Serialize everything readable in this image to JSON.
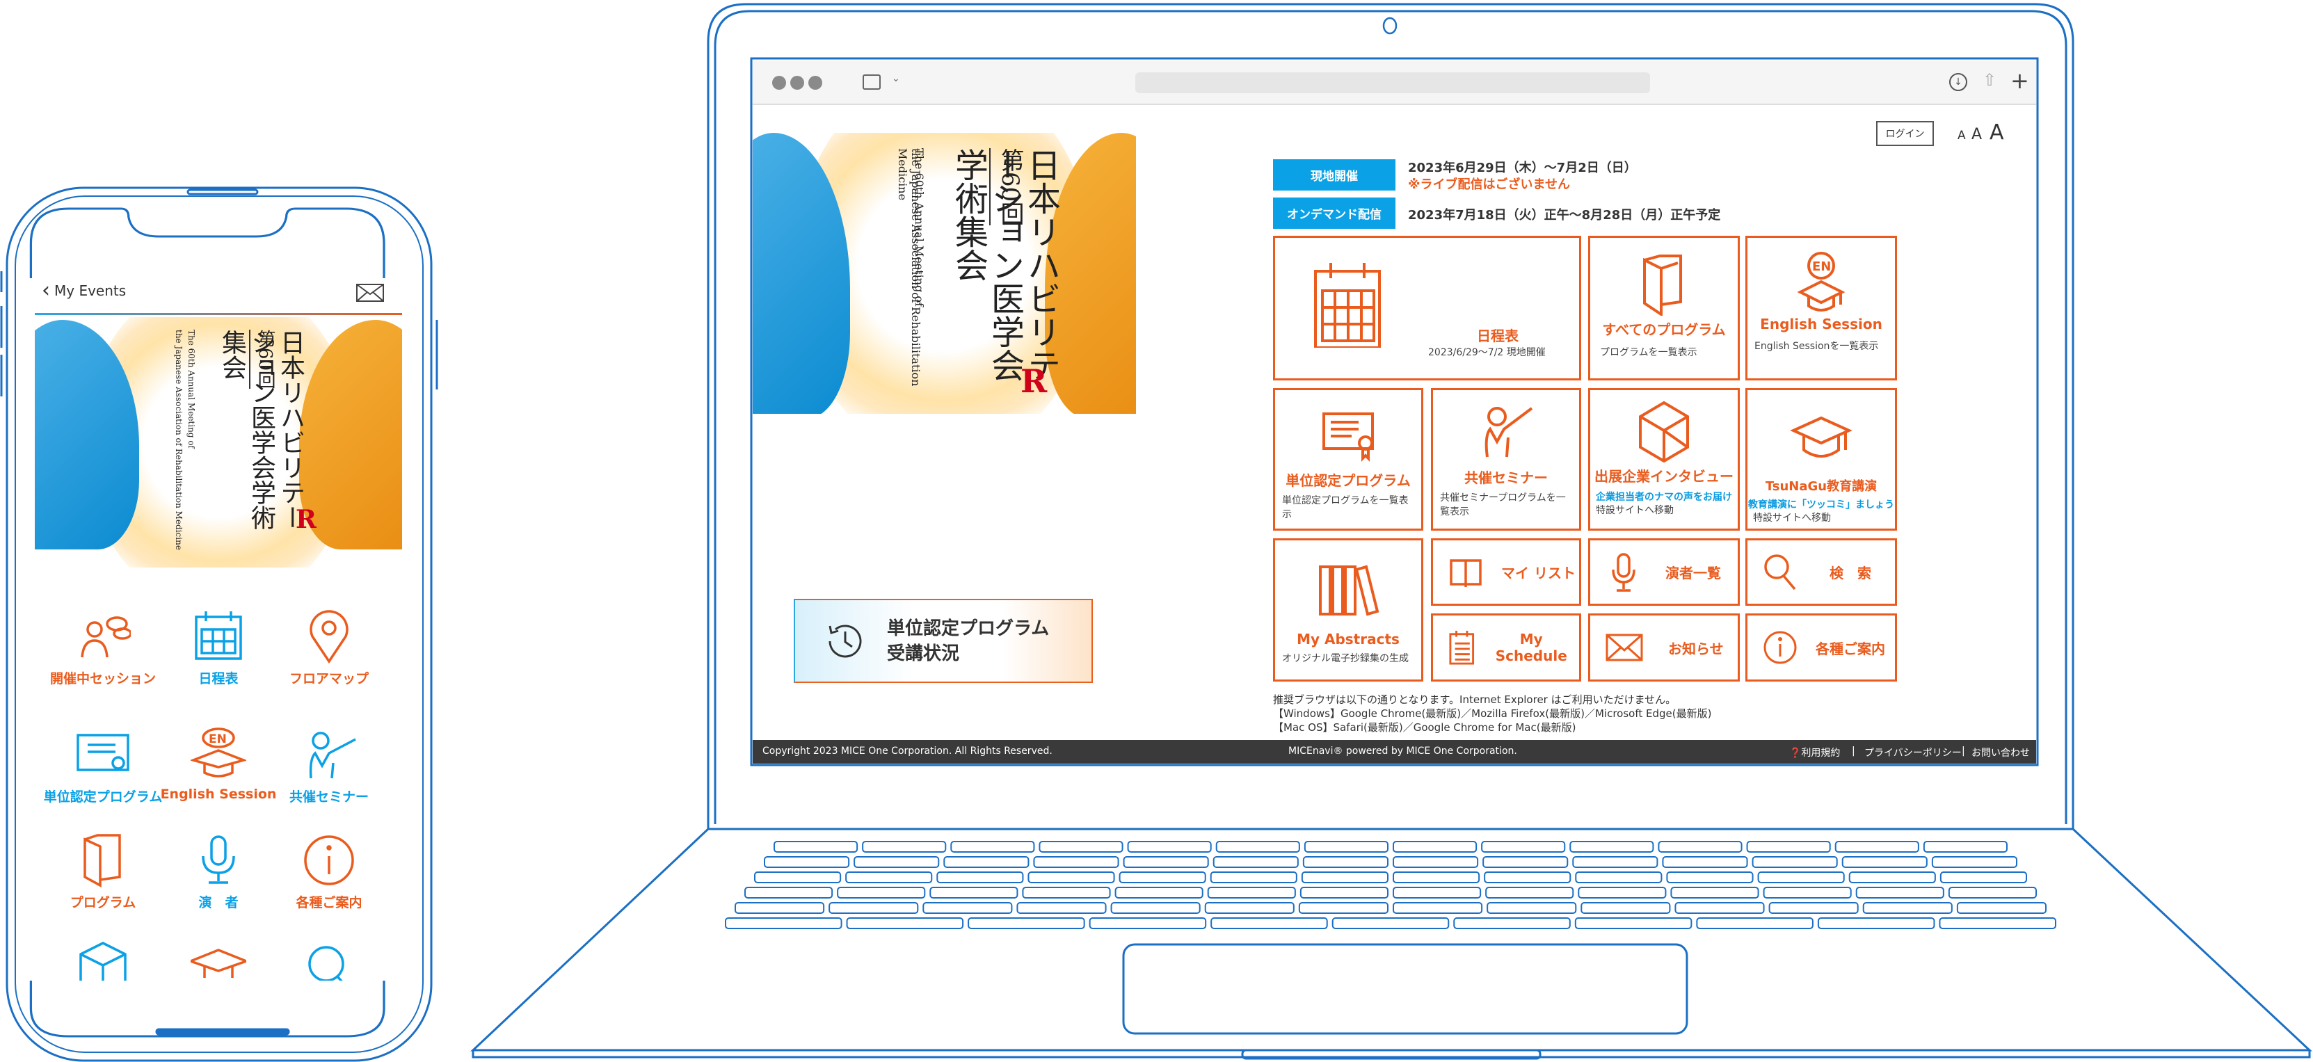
{
  "colors": {
    "accent_orange": "#ea5c1e",
    "accent_blue": "#0aa1e6",
    "device_outline": "#1b6fc4",
    "footer_bg": "#3a3a3a"
  },
  "browser": {
    "icons": [
      "traffic-lights",
      "sidebar-icon",
      "chevron-down-icon",
      "download-icon",
      "share-icon",
      "new-tab-icon"
    ]
  },
  "banner": {
    "edition": "第60回",
    "title_jp": "日本リハビリテーション医学会学術集会",
    "title_en_1": "The 60th Annual Meeting of",
    "title_en_2": "the Japanese Association of Rehabilitation Medicine"
  },
  "status_button": {
    "line1": "単位認定プログラム",
    "line2": "受講状況",
    "icon": "clock-history-icon"
  },
  "header": {
    "login": "ログイン",
    "font_sizes": [
      "A",
      "A",
      "A"
    ]
  },
  "schedule": [
    {
      "label": "現地開催",
      "dates": "2023年6月29日（木）～7月2日（日）",
      "note": "※ライブ配信はございません"
    },
    {
      "label": "オンデマンド配信",
      "dates": "2023年7月18日（火）正午～8月28日（月）正午予定"
    }
  ],
  "tiles": {
    "schedule": {
      "title": "日程表",
      "desc": "2023/6/29～7/2 現地開催"
    },
    "all_programs": {
      "title": "すべてのプログラム",
      "desc": "プログラムを一覧表示"
    },
    "english": {
      "title": "English Session",
      "desc": "English Sessionを一覧表示"
    },
    "credit": {
      "title": "単位認定プログラム",
      "desc": "単位認定プログラムを一覧表示"
    },
    "seminar": {
      "title": "共催セミナー",
      "desc": "共催セミナープログラムを一覧表示"
    },
    "exhibitor": {
      "title": "出展企業インタビュー",
      "highlight": "企業担当者のナマの声をお届け",
      "desc": "特設サイトへ移動"
    },
    "tsunagu": {
      "title": "TsuNaGu教育講演",
      "highlight": "教育講演に「ツッコミ」ましょう",
      "desc": "特設サイトへ移動"
    },
    "abstracts": {
      "title": "My Abstracts",
      "desc": "オリジナル電子抄録集の生成"
    },
    "mylist": {
      "title": "マイ リスト"
    },
    "speakers": {
      "title": "演者一覧"
    },
    "search": {
      "title": "検　索"
    },
    "myschedule": {
      "title": "My Schedule"
    },
    "news": {
      "title": "お知らせ"
    },
    "guide": {
      "title": "各種ご案内"
    }
  },
  "browser_note": {
    "line1": "推奨ブラウザは以下の通りとなります。Internet Explorer はご利用いただけません。",
    "line2": "【Windows】Google Chrome(最新版)／Mozilla Firefox(最新版)／Microsoft Edge(最新版)",
    "line3": "【Mac OS】Safari(最新版)／Google Chrome for Mac(最新版)"
  },
  "footer": {
    "copyright": "Copyright 2023 MICE One Corporation. All Rights Reserved.",
    "powered": "MICEnavi® powered by MICE One Corporation.",
    "terms": "❓利用規約",
    "privacy": "プライバシーポリシー",
    "contact": "お問い合わせ",
    "sep": "|"
  },
  "phone": {
    "back": "My Events",
    "items": [
      {
        "label": "開催中セッション",
        "color": "#ea5c1e",
        "icon": "session-icon"
      },
      {
        "label": "日程表",
        "color": "#0aa1e6",
        "icon": "calendar-icon"
      },
      {
        "label": "フロアマップ",
        "color": "#ea5c1e",
        "icon": "map-pin-icon"
      },
      {
        "label": "単位認定プログラム",
        "color": "#0aa1e6",
        "icon": "certificate-icon"
      },
      {
        "label": "English Session",
        "color": "#ea5c1e",
        "icon": "english-cap-icon"
      },
      {
        "label": "共催セミナー",
        "color": "#0aa1e6",
        "icon": "presenter-icon"
      },
      {
        "label": "プログラム",
        "color": "#ea5c1e",
        "icon": "book-icon"
      },
      {
        "label": "演　者",
        "color": "#0aa1e6",
        "icon": "microphone-icon"
      },
      {
        "label": "各種ご案内",
        "color": "#ea5c1e",
        "icon": "info-icon"
      },
      {
        "label": "",
        "color": "#0aa1e6",
        "icon": "building-icon"
      },
      {
        "label": "",
        "color": "#ea5c1e",
        "icon": "graduation-cap-icon"
      },
      {
        "label": "",
        "color": "#0aa1e6",
        "icon": "search-icon"
      }
    ]
  }
}
